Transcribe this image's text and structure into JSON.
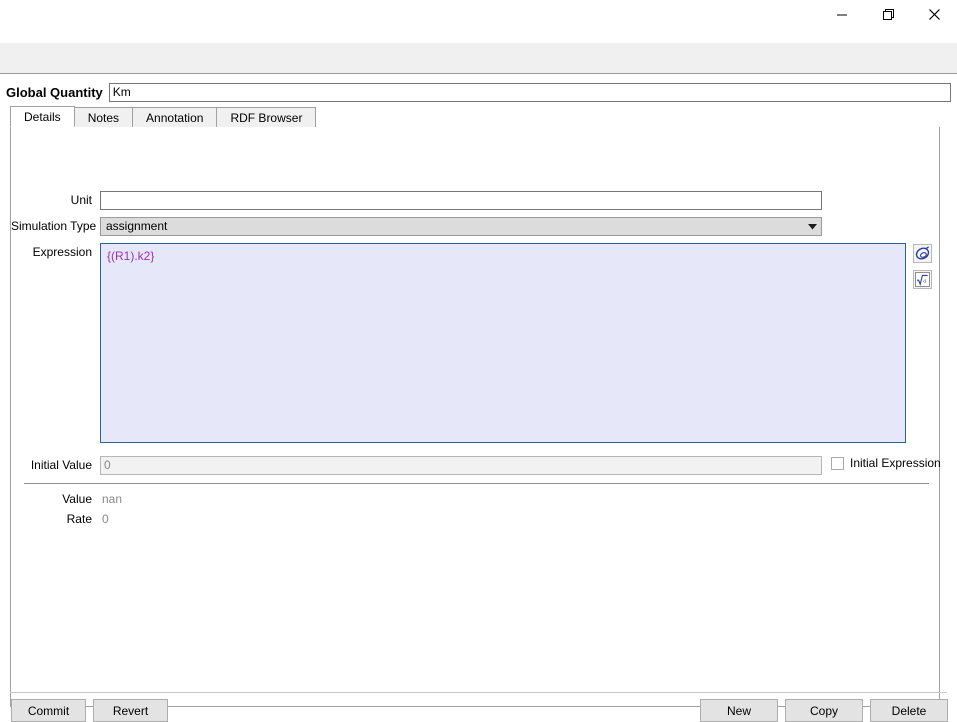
{
  "window": {
    "controls": [
      {
        "name": "minimize",
        "glyph": "minimize-icon"
      },
      {
        "name": "restore",
        "glyph": "restore-icon"
      },
      {
        "name": "close",
        "glyph": "close-icon"
      }
    ]
  },
  "header": {
    "label": "Global Quantity",
    "name_value": "Km",
    "name_placeholder": ""
  },
  "tabs": [
    {
      "label": "Details",
      "active": true
    },
    {
      "label": "Notes",
      "active": false
    },
    {
      "label": "Annotation",
      "active": false
    },
    {
      "label": "RDF Browser",
      "active": false
    }
  ],
  "details": {
    "unit": {
      "label": "Unit",
      "value": "",
      "placeholder": ""
    },
    "simulation_type": {
      "label": "Simulation Type",
      "value": "assignment"
    },
    "expression": {
      "label": "Expression",
      "value": "{(R1).k2}",
      "text_color": "#9b33b0",
      "background": "#e7e7fa",
      "border_color": "#2a6496"
    },
    "expression_tools": [
      {
        "name": "object-browser-icon",
        "tooltip": ""
      },
      {
        "name": "math-function-icon",
        "tooltip": ""
      }
    ],
    "initial_value": {
      "label": "Initial Value",
      "value": "0"
    },
    "initial_expression": {
      "label": "Initial Expression",
      "checked": false
    },
    "value": {
      "label": "Value",
      "value": "nan"
    },
    "rate": {
      "label": "Rate",
      "value": "0"
    }
  },
  "buttons": {
    "left": [
      {
        "label": "Commit",
        "name": "commit-button"
      },
      {
        "label": "Revert",
        "name": "revert-button"
      }
    ],
    "right": [
      {
        "label": "New",
        "name": "new-button"
      },
      {
        "label": "Copy",
        "name": "copy-button"
      },
      {
        "label": "Delete",
        "name": "delete-button"
      }
    ]
  }
}
